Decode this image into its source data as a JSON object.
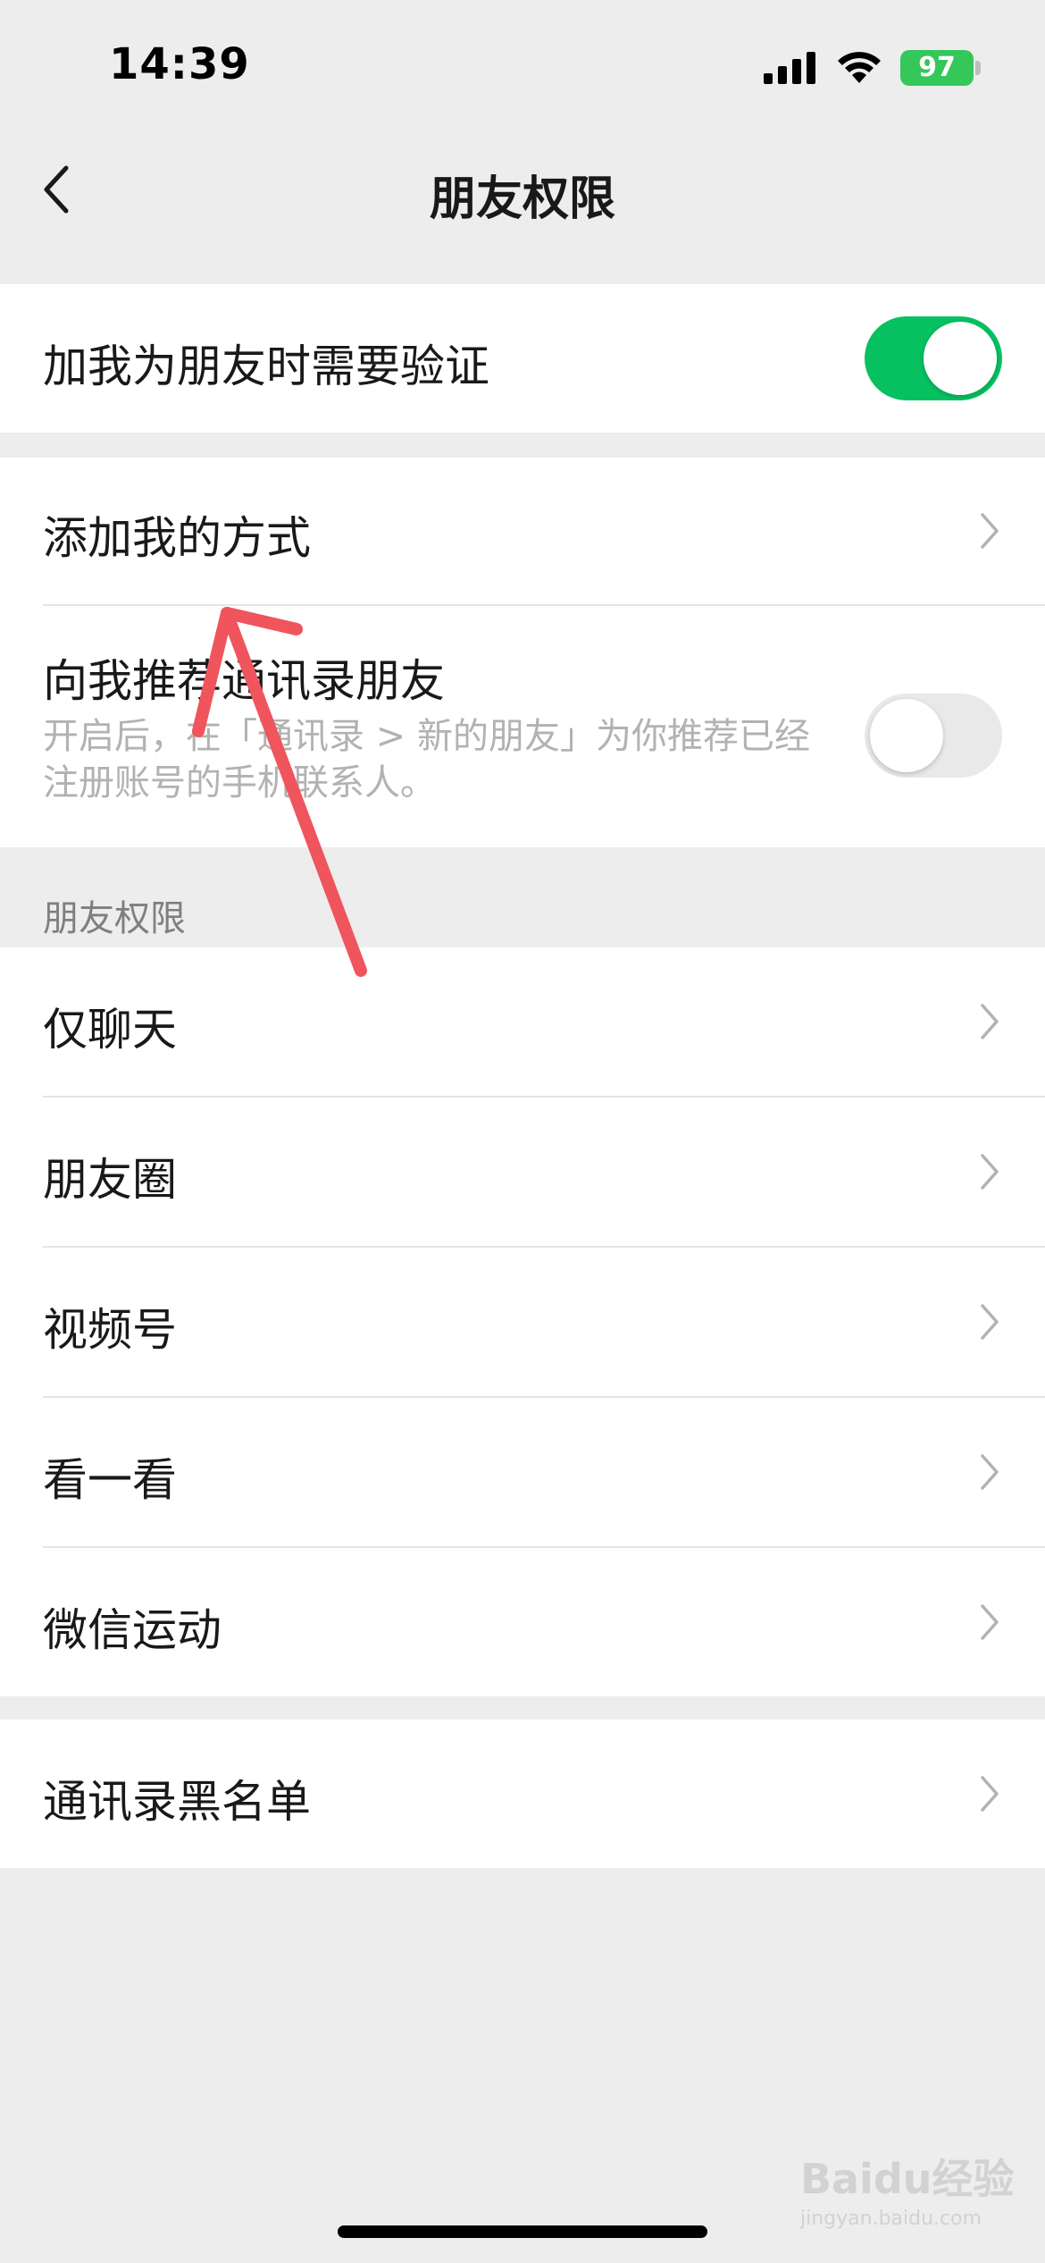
{
  "status_bar": {
    "time": "14:39",
    "battery": "97"
  },
  "nav": {
    "title": "朋友权限"
  },
  "group1": {
    "verify_label": "加我为朋友时需要验证",
    "verify_on": true
  },
  "group2": {
    "add_method_label": "添加我的方式",
    "recommend_label": "向我推荐通讯录朋友",
    "recommend_desc": "开启后，在「通讯录 > 新的朋友」为你推荐已经注册账号的手机联系人。",
    "recommend_on": false
  },
  "section": {
    "header": "朋友权限",
    "items": [
      {
        "label": "仅聊天"
      },
      {
        "label": "朋友圈"
      },
      {
        "label": "视频号"
      },
      {
        "label": "看一看"
      },
      {
        "label": "微信运动"
      }
    ]
  },
  "group4": {
    "blacklist_label": "通讯录黑名单"
  },
  "watermark": {
    "brand": "Baidu经验",
    "url": "jingyan.baidu.com"
  },
  "colors": {
    "accent_green": "#07c160",
    "background": "#ededed",
    "annotation_arrow": "#f0545c"
  },
  "icons": [
    "signal-icon",
    "wifi-icon",
    "battery-icon",
    "back-chevron-icon",
    "chevron-right-icon"
  ]
}
